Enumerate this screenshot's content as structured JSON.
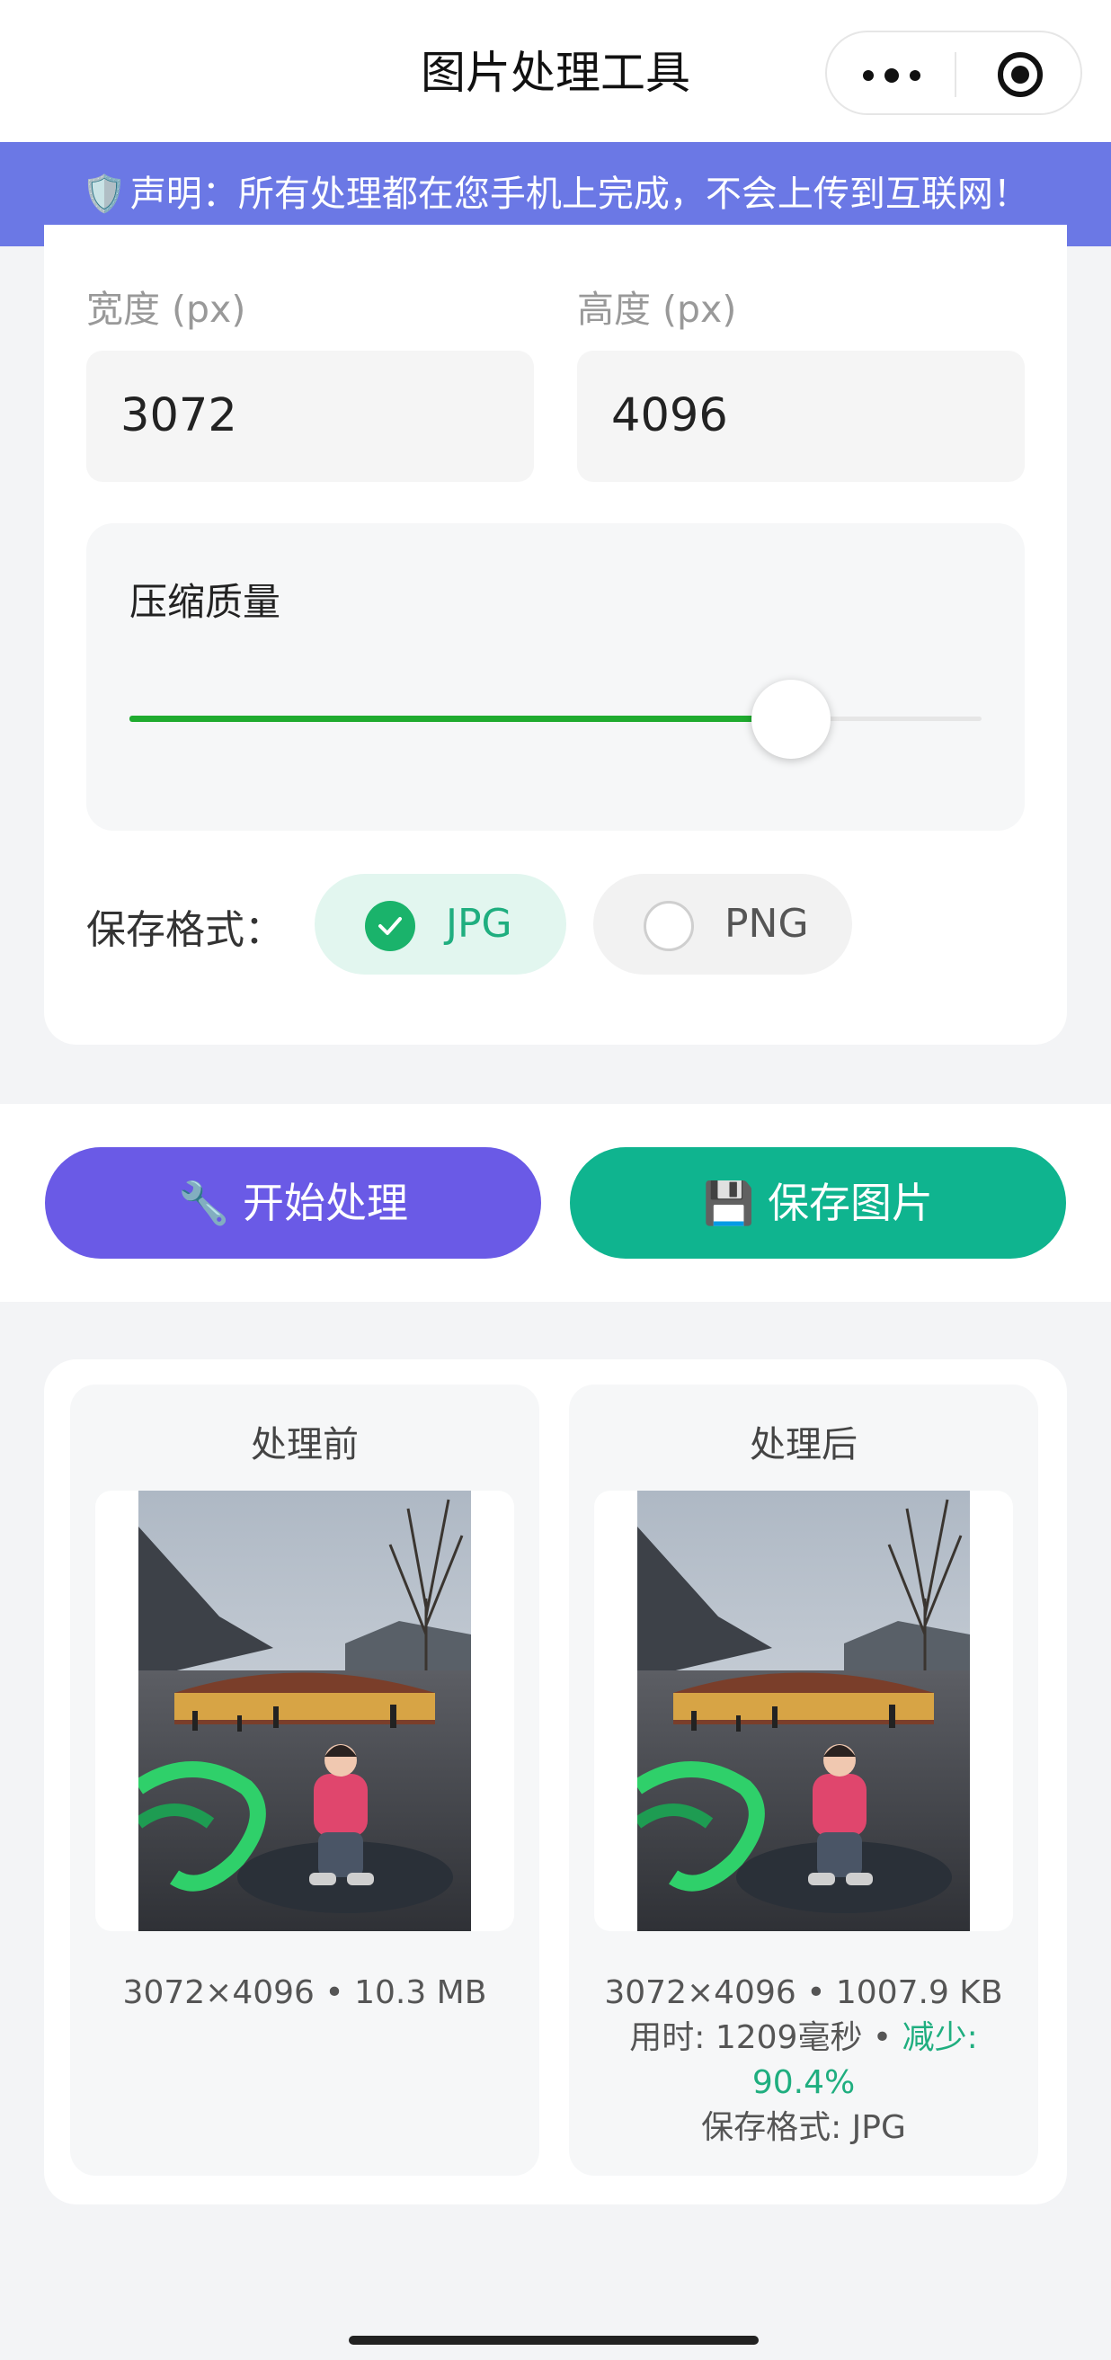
{
  "header": {
    "title": "图片处理工具"
  },
  "notice": {
    "icon": "🛡️",
    "text": "声明：所有处理都在您手机上完成，不会上传到互联网！"
  },
  "size": {
    "width_label": "宽度 (px)",
    "width_value": "3072",
    "height_label": "高度 (px)",
    "height_value": "4096"
  },
  "quality": {
    "label": "压缩质量",
    "level": 0.78
  },
  "format": {
    "label": "保存格式：",
    "options": [
      "JPG",
      "PNG"
    ],
    "selected": "JPG"
  },
  "actions": {
    "process_label": "🔧 开始处理",
    "save_label": "💾 保存图片"
  },
  "compare": {
    "before": {
      "title": "处理前",
      "info": "3072×4096 • 10.3 MB"
    },
    "after": {
      "title": "处理后",
      "info": "3072×4096 • 1007.9 KB",
      "time_text": "用时: 1209毫秒 •",
      "reduce_label": "减少:",
      "reduce_value": "90.4%",
      "format_text": "保存格式: JPG"
    }
  },
  "colors": {
    "accent_purple": "#6a5ae6",
    "accent_green": "#0fb48f",
    "notice_bg": "#6b78e5",
    "slider_green": "#1fab2f"
  }
}
